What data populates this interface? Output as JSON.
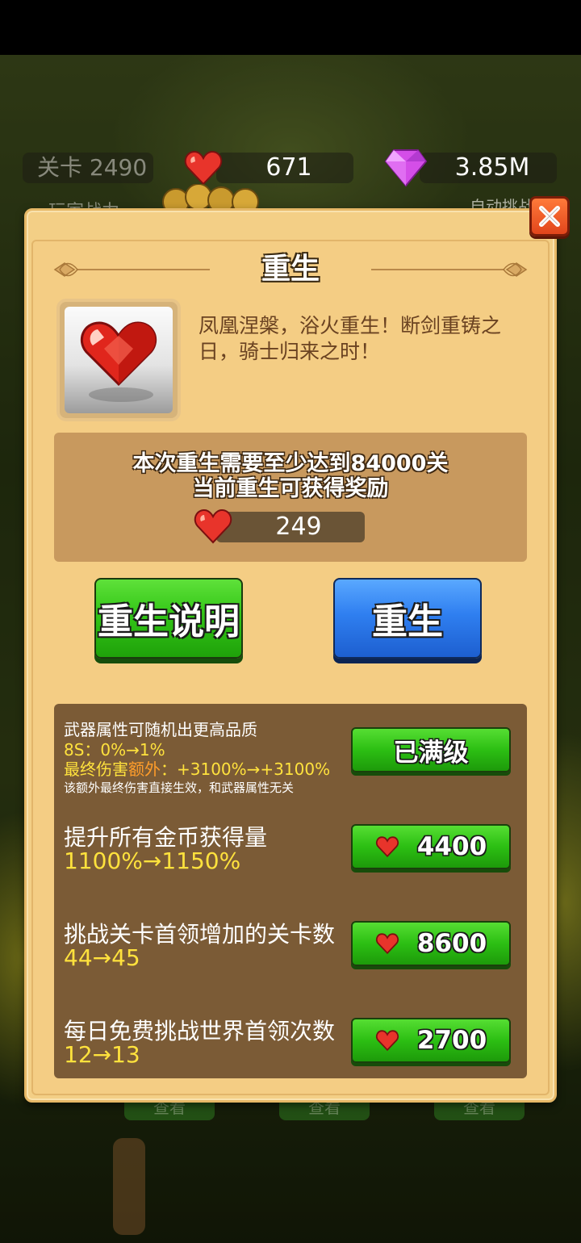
{
  "hud": {
    "level_label": "关卡 2490",
    "hearts": "671",
    "gems": "3.85M",
    "player_power_label": "玩家战力",
    "auto_challenge_label": "自动挑战"
  },
  "background": {
    "tab_label": "查看"
  },
  "dialog": {
    "title": "重生",
    "description": "凤凰涅槃，浴火重生！断剑重铸之日，骑士归来之时！",
    "requirement_line1": "本次重生需要至少达到84000关",
    "requirement_line2": "当前重生可获得奖励",
    "reward_amount": "249",
    "explain_button": "重生说明",
    "rebirth_button": "重生"
  },
  "upgrades": [
    {
      "title": "武器属性可随机出更高品质",
      "line2": "8S：0%→1%",
      "line3_prefix": "最终伤害",
      "line3_highlight": "额外",
      "line3_value": "：+3100%→+3100%",
      "note": "该额外最终伤害直接生效，和武器属性无关",
      "button": "已满级"
    },
    {
      "title": "提升所有金币获得量",
      "value": "1100%→1150%",
      "cost": "4400"
    },
    {
      "title": "挑战关卡首领增加的关卡数",
      "value": "44→45",
      "cost": "8600"
    },
    {
      "title": "每日免费挑战世界首领次数",
      "value": "12→13",
      "cost": "2700"
    }
  ],
  "colors": {
    "panel_bg": "#f4cd84",
    "green_button": "#33c617",
    "blue_button": "#2f7ff0",
    "upgrade_bg": "#7b5b36",
    "highlight_yellow": "#ffe23d"
  }
}
